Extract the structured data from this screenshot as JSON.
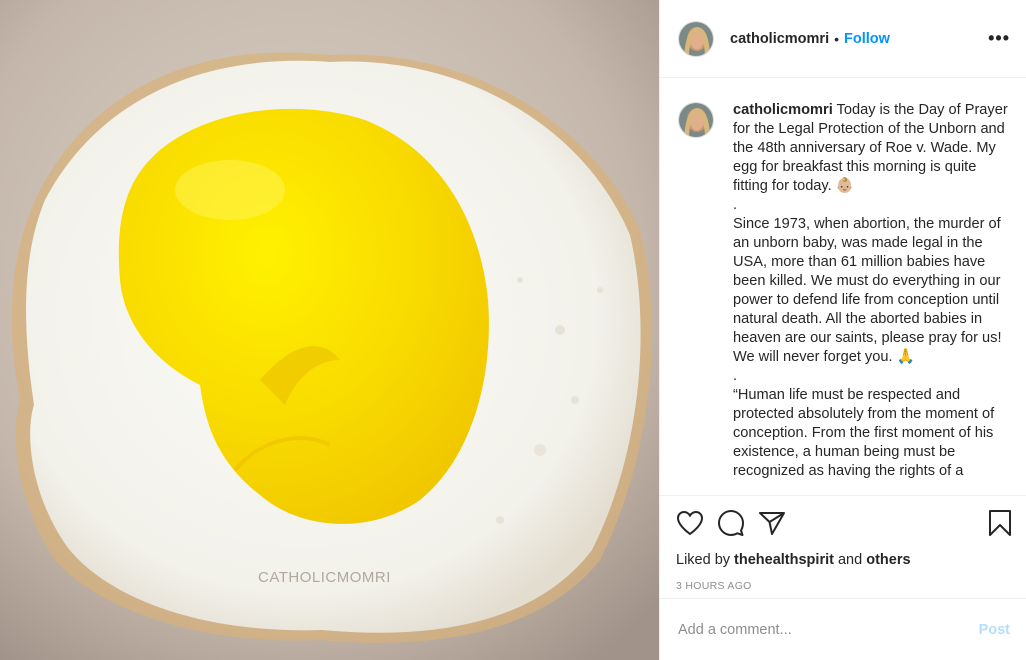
{
  "post": {
    "watermark": "CATHOLICMOMRI"
  },
  "header": {
    "username": "catholicmomri",
    "separator": "•",
    "follow_label": "Follow",
    "more_label": "•••"
  },
  "caption": {
    "username": "catholicmomri",
    "paragraphs": [
      "Today is the Day of Prayer for the Legal Protection of the Unborn and the 48th anniversary of Roe v. Wade. My egg for breakfast this morning is quite fitting for today. 👶🏼",
      ".",
      "Since 1973, when abortion, the murder of an unborn baby, was made legal in the USA, more than 61 million babies have been killed. We must do everything in our power to defend life from conception until natural death. All the aborted babies in heaven are our saints, please pray for us! We will never forget you. 🙏",
      ".",
      "“Human life must be respected and protected absolutely from the moment of conception. From the first moment of his existence, a human being must be recognized as having the rights of a"
    ]
  },
  "actions": {
    "icons": [
      "heart-icon",
      "comment-icon",
      "share-icon",
      "bookmark-icon"
    ],
    "liked_by_prefix": "Liked by",
    "liked_by_user": "thehealthspirit",
    "liked_by_and": "and",
    "liked_by_others": "others",
    "timestamp": "3 HOURS AGO"
  },
  "comment": {
    "placeholder": "Add a comment...",
    "post_label": "Post"
  },
  "colors": {
    "link_blue": "#0095f6",
    "post_disabled": "#b2dffc",
    "yolk": "#f7d600",
    "white": "#f8f7f2"
  }
}
